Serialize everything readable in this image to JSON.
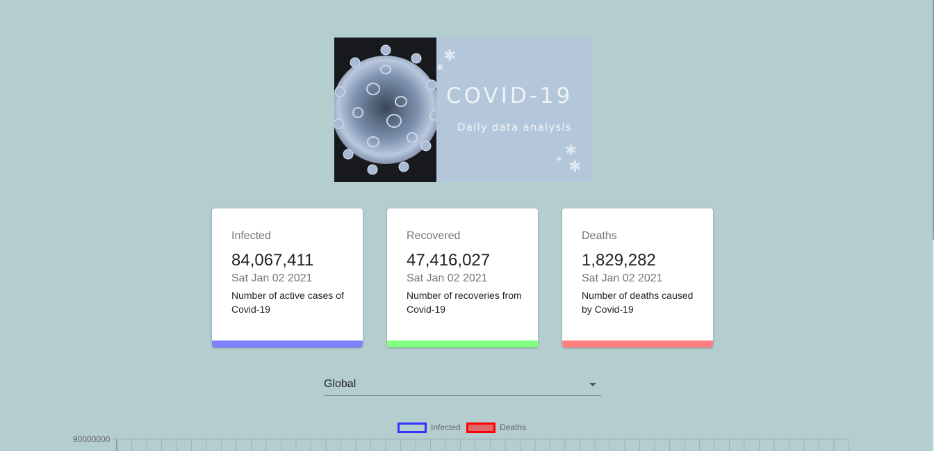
{
  "banner": {
    "title": "COVID-19",
    "subtitle": "Daily data analysis"
  },
  "cards": [
    {
      "label": "Infected",
      "value": "84,067,411",
      "date": "Sat Jan 02 2021",
      "description": "Number of active cases of Covid-19",
      "color": "#8080ff"
    },
    {
      "label": "Recovered",
      "value": "47,416,027",
      "date": "Sat Jan 02 2021",
      "description": "Number of recoveries from Covid-19",
      "color": "#80ff80"
    },
    {
      "label": "Deaths",
      "value": "1,829,282",
      "date": "Sat Jan 02 2021",
      "description": "Number of deaths caused by Covid-19",
      "color": "#ff8080"
    }
  ],
  "country_select": {
    "selected": "Global"
  },
  "chart": {
    "legend": [
      {
        "label": "Infected",
        "border_color": "#3333ff",
        "fill_color": "#b4cdcf"
      },
      {
        "label": "Deaths",
        "border_color": "#ff0000",
        "fill_color": "#e06a6a"
      }
    ],
    "y_tick_top": "90000000"
  },
  "chart_data": {
    "type": "line",
    "title": "",
    "xlabel": "",
    "ylabel": "",
    "series": [
      {
        "name": "Infected",
        "values": []
      },
      {
        "name": "Deaths",
        "values": []
      }
    ],
    "y_ticks": [
      90000000
    ],
    "grid": true,
    "legend_placement": "top-center"
  }
}
